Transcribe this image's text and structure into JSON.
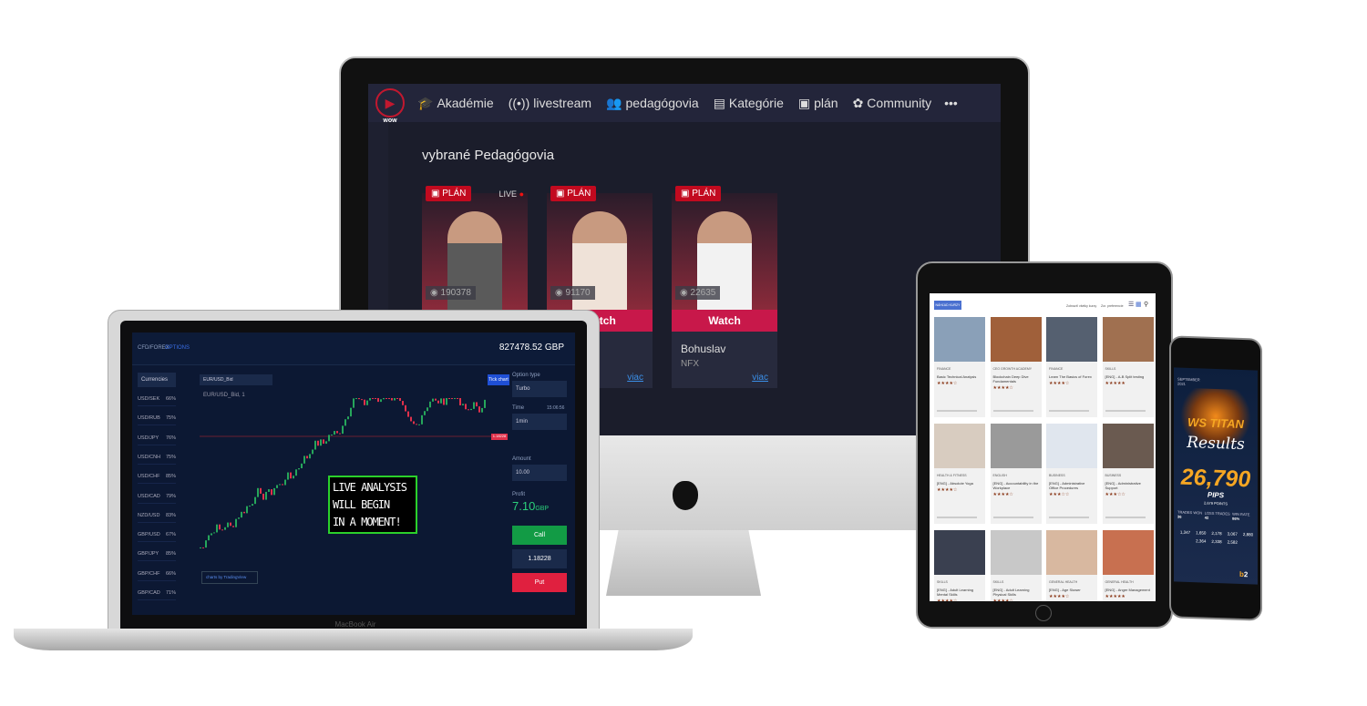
{
  "desktop": {
    "nav": {
      "logo_text": "wow",
      "items": [
        {
          "icon": "graduation-cap-icon",
          "glyph": "🎓",
          "label": "Akadémie"
        },
        {
          "icon": "broadcast-icon",
          "glyph": "((•))",
          "label": "livestream"
        },
        {
          "icon": "users-icon",
          "glyph": "👥",
          "label": "pedagógovia"
        },
        {
          "icon": "list-icon",
          "glyph": "▤",
          "label": "Kategórie"
        },
        {
          "icon": "calendar-icon",
          "glyph": "▣",
          "label": "plán"
        },
        {
          "icon": "community-icon",
          "glyph": "✿",
          "label": "Community"
        }
      ],
      "more": "•••"
    },
    "section_title": "vybrané Pedagógovia",
    "cards": [
      {
        "badge": "PLÁN",
        "live": "LIVE",
        "views": "190378",
        "watch": "",
        "name": "",
        "sub": "",
        "more": "",
        "shirt": "#5a5a5a"
      },
      {
        "badge": "PLÁN",
        "views": "91170",
        "watch": "Watch",
        "name": "",
        "sub": "",
        "more": "viac",
        "shirt": "#efe2d8"
      },
      {
        "badge": "PLÁN",
        "views": "22635",
        "watch": "Watch",
        "name": "Bohuslav",
        "sub": "NFX",
        "more": "viac",
        "shirt": "#f2f2f2"
      }
    ]
  },
  "laptop": {
    "brand": "MacBook Air",
    "tabs": [
      "CFD/FOREX",
      "OPTIONS"
    ],
    "balance": "827478.52 GBP",
    "currency_header": "Currencies",
    "currencies": [
      [
        "USD/SEK",
        "66%"
      ],
      [
        "USD/RUB",
        "75%"
      ],
      [
        "USD/JPY",
        "76%"
      ],
      [
        "USD/CNH",
        "75%"
      ],
      [
        "USD/CHF",
        "85%"
      ],
      [
        "USD/CAD",
        "79%"
      ],
      [
        "NZD/USD",
        "83%"
      ],
      [
        "GBP/USD",
        "67%"
      ],
      [
        "GBP/JPY",
        "85%"
      ],
      [
        "GBP/CHF",
        "66%"
      ],
      [
        "GBP/CAD",
        "71%"
      ]
    ],
    "symbol": "EUR/USD_Bid",
    "chart_title": "EUR/USD_Bid, 1",
    "overlay": [
      "LIVE ANALYSIS",
      "WILL BEGIN",
      "IN A MOMENT!"
    ],
    "tick_chart": "Tick chart",
    "option_type_label": "Option type",
    "option_type": "Turbo",
    "time_label": "Time",
    "time_value": "15:06:56",
    "time_option": "1min",
    "amount_label": "Amount",
    "amount": "10.00",
    "profit_label": "Profit",
    "profit": "7.10",
    "profit_currency": "GBP",
    "call": "Call",
    "price": "1.18228",
    "put": "Put",
    "price_tag": "1.18228",
    "credit": "charts by TradingView",
    "up_color": "#26a65b",
    "down_color": "#e0314b"
  },
  "tablet": {
    "button": "NÁHĽAD KURZY",
    "filter1": "Zobraziť všetky kurzy",
    "filter2": "Zor. preferencie",
    "courses": [
      {
        "cat": "FINANCE",
        "title": "Basic Technical Analysis",
        "stars": "★★★★☆",
        "c": "#8aa0b8"
      },
      {
        "cat": "CEO GROWTH ACADEMY",
        "title": "Blockchain Deep Dive Fundamentals",
        "stars": "★★★★☆",
        "c": "#a0603a"
      },
      {
        "cat": "FINANCE",
        "title": "Learn The Basics of Forex",
        "stars": "★★★★☆",
        "c": "#556070"
      },
      {
        "cat": "SKILLS",
        "title": "[ENG] - A-B Split testing",
        "stars": "★★★★★",
        "c": "#a07050"
      },
      {
        "cat": "HEALTH & FITNESS",
        "title": "[ENG] - Absolute Yoga",
        "stars": "★★★★☆",
        "c": "#d8ccc0"
      },
      {
        "cat": "ENGLISH",
        "title": "[ENG] - Accountability in the Workplace",
        "stars": "★★★★☆",
        "c": "#9a9a9a"
      },
      {
        "cat": "BUSINESS",
        "title": "[ENG] - Administrative Office Procedures",
        "stars": "★★★☆☆",
        "c": "#e0e6ee"
      },
      {
        "cat": "BUSINESS",
        "title": "[ENG] - Administrative Support",
        "stars": "★★★☆☆",
        "c": "#6a5a50"
      },
      {
        "cat": "SKILLS",
        "title": "[ENG] - Adult Learning Mental Skills",
        "stars": "★★★★☆",
        "c": "#3a4050"
      },
      {
        "cat": "SKILLS",
        "title": "[ENG] - Adult Learning Physical Skills",
        "stars": "★★★★☆",
        "c": "#c8c8c8"
      },
      {
        "cat": "GENERAL HEALTH",
        "title": "[ENG] - Age Slower",
        "stars": "★★★★☆",
        "c": "#d8b8a0"
      },
      {
        "cat": "GENERAL HEALTH",
        "title": "[ENG] - Anger Management",
        "stars": "★★★★★",
        "c": "#c87050"
      }
    ]
  },
  "phone": {
    "month": "SEPTEMBER 2021",
    "headline": "WS TITAN",
    "script": "Results",
    "pips": "26,790",
    "pips_label": "PIPS",
    "points": "2,679 POINTS",
    "stats": [
      [
        "TRADES WON",
        "36"
      ],
      [
        "LOSS TRADES",
        "42"
      ],
      [
        "WIN RATE",
        "86%"
      ]
    ],
    "results": [
      "1,347",
      "1,650",
      "2,178",
      "3,067",
      "2,880",
      "2,364",
      "2,338",
      "2,582"
    ],
    "logo": "b2"
  }
}
